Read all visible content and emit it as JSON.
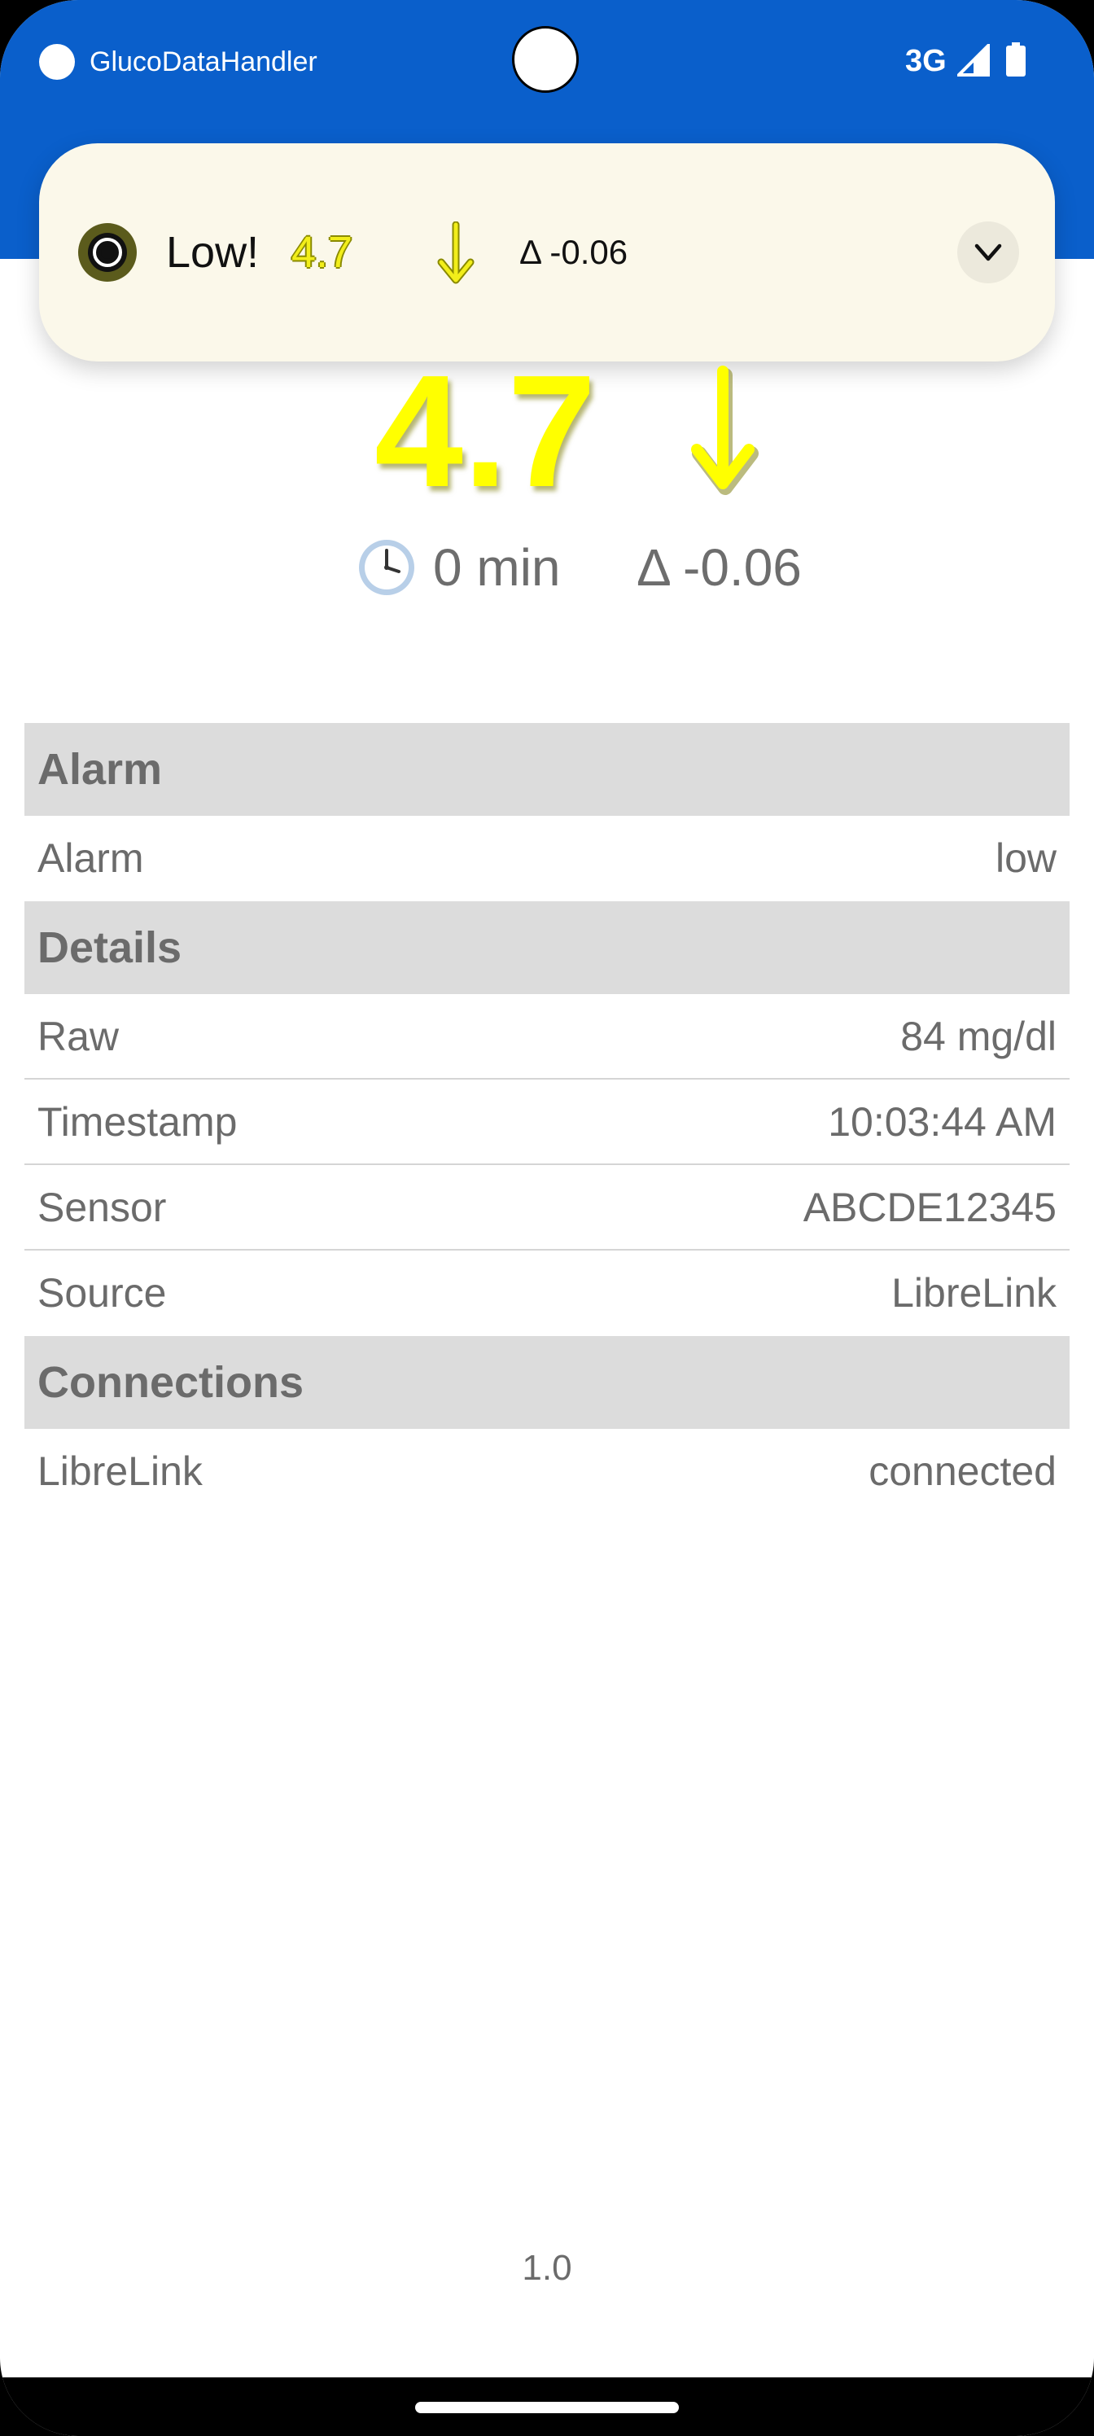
{
  "status_bar": {
    "app_name": "GlucoDataHandler",
    "network": "3G"
  },
  "notification": {
    "title": "Low!",
    "value": "4.7",
    "delta": "Δ -0.06",
    "value_color": "#F2EE1A",
    "icons": [
      "app-icon",
      "arrow-down-icon",
      "expand-icon"
    ]
  },
  "glucose": {
    "value": "4.7",
    "age": "0 min",
    "delta": "Δ -0.06",
    "value_color": "#FFFF00",
    "icons": [
      "arrow-down-icon",
      "clock-icon"
    ]
  },
  "table": {
    "alarm": {
      "header": "Alarm",
      "rows": [
        {
          "key": "Alarm",
          "value": "low"
        }
      ]
    },
    "details": {
      "header": "Details",
      "rows": [
        {
          "key": "Raw",
          "value": "84 mg/dl"
        },
        {
          "key": "Timestamp",
          "value": "10:03:44 AM"
        },
        {
          "key": "Sensor",
          "value": "ABCDE12345"
        },
        {
          "key": "Source",
          "value": "LibreLink"
        }
      ]
    },
    "connections": {
      "header": "Connections",
      "rows": [
        {
          "key": "LibreLink",
          "value": "connected"
        }
      ]
    }
  },
  "version": "1.0",
  "colors": {
    "app_bar": "#0A5FCB",
    "section_header_bg": "#DCDCDC",
    "notification_bg": "#FBF8EA"
  }
}
